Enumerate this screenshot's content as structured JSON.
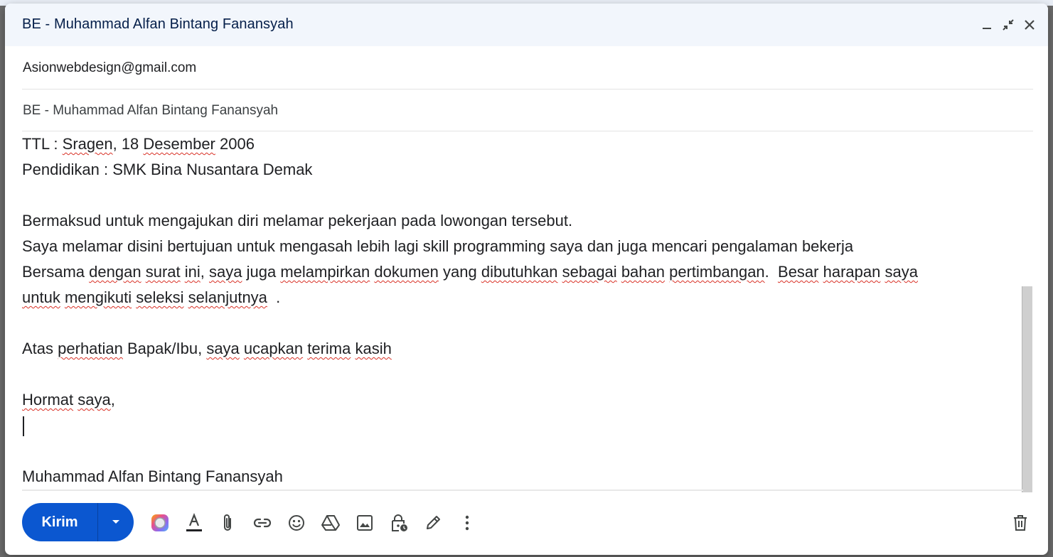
{
  "compose": {
    "title": "BE - Muhammad Alfan Bintang Fanansyah",
    "to": "Asionwebdesign@gmail.com",
    "subject": "BE - Muhammad Alfan Bintang Fanansyah",
    "body": {
      "l1a": "TTL : ",
      "l1b": "Sragen",
      "l1c": ", 18 ",
      "l1d": "Desember",
      "l1e": " 2006",
      "l2": "Pendidikan : SMK Bina Nusantara Demak",
      "l4": "Bermaksud untuk mengajukan diri melamar pekerjaan pada lowongan tersebut.",
      "l5": "Saya melamar disini bertujuan untuk mengasah lebih lagi skill programming saya dan juga mencari pengalaman bekerja",
      "l6a": "Bersama ",
      "l6b": "dengan",
      "l6c": " ",
      "l6d": "surat",
      "l6e": " ",
      "l6f": "ini",
      "l6g": ", ",
      "l6h": "saya",
      "l6i": " juga ",
      "l6j": "melampirkan",
      "l6k": " ",
      "l6l": "dokumen",
      "l6m": " yang ",
      "l6n": "dibutuhkan",
      "l6o": " ",
      "l6p": "sebagai",
      "l6q": " ",
      "l6r": "bahan",
      "l6s": " ",
      "l6t": "pertimbangan",
      "l6u": ".  ",
      "l6v": "Besar",
      "l6w": " ",
      "l6x": "harapan",
      "l6y": " ",
      "l6z": "saya",
      "l7a": "untuk",
      "l7b": " ",
      "l7c": "mengikuti",
      "l7d": " ",
      "l7e": "seleksi",
      "l7f": " ",
      "l7g": "selanjutnya",
      "l7h": "  .",
      "l9a": "Atas ",
      "l9b": "perhatian",
      "l9c": " Bapak/Ibu, ",
      "l9d": "saya",
      "l9e": " ",
      "l9f": "ucapkan",
      "l9g": " ",
      "l9h": "terima",
      "l9i": " ",
      "l9j": "kasih",
      "l11a": "Hormat",
      "l11b": " ",
      "l11c": "saya",
      "l11d": ",",
      "signature": "Muhammad Alfan Bintang Fanansyah"
    }
  },
  "toolbar": {
    "send_label": "Kirim",
    "icons": [
      "send-options-icon",
      "gemini-icon",
      "text-format-icon",
      "attach-icon",
      "link-icon",
      "emoji-icon",
      "drive-icon",
      "image-icon",
      "confidential-icon",
      "signature-icon",
      "more-options-icon",
      "trash-icon"
    ]
  },
  "colors": {
    "send": "#0b57d0",
    "header": "#f2f6fc",
    "spellcheck": "#d93025"
  }
}
